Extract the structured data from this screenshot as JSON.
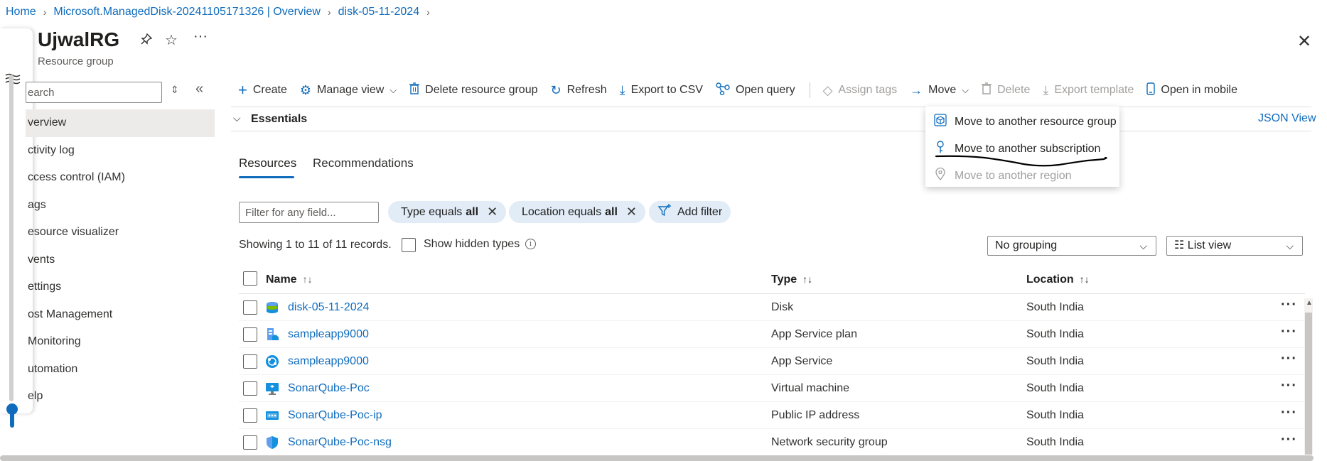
{
  "breadcrumb": {
    "items": [
      "Home",
      "Microsoft.ManagedDisk-20241105171326 | Overview",
      "disk-05-11-2024"
    ]
  },
  "header": {
    "title": "UjwalRG",
    "subtitle": "Resource group"
  },
  "sidebar": {
    "search_placeholder": "earch",
    "items": [
      {
        "label": "verview",
        "active": true
      },
      {
        "label": "ctivity log"
      },
      {
        "label": "ccess control (IAM)"
      },
      {
        "label": "ags"
      },
      {
        "label": "esource visualizer"
      },
      {
        "label": "vents"
      },
      {
        "label": "ettings"
      },
      {
        "label": "ost Management"
      },
      {
        "label": "Monitoring"
      },
      {
        "label": "utomation"
      },
      {
        "label": "elp"
      }
    ]
  },
  "toolbar": {
    "create": "Create",
    "manage_view": "Manage view",
    "delete_rg": "Delete resource group",
    "refresh": "Refresh",
    "export_csv": "Export to CSV",
    "open_query": "Open query",
    "assign_tags": "Assign tags",
    "move": "Move",
    "delete": "Delete",
    "export_template": "Export template",
    "open_mobile": "Open in mobile"
  },
  "essentials": {
    "label": "Essentials",
    "json_view": "JSON View"
  },
  "move_menu": {
    "items": [
      {
        "label": "Move to another resource group",
        "enabled": true
      },
      {
        "label": "Move to another subscription",
        "enabled": true
      },
      {
        "label": "Move to another region",
        "enabled": false
      }
    ]
  },
  "tabs": {
    "resources": "Resources",
    "recommendations": "Recommendations"
  },
  "filters": {
    "placeholder": "Filter for any field...",
    "type_prefix": "Type equals",
    "type_value": "all",
    "location_prefix": "Location equals",
    "location_value": "all",
    "add_filter": "Add filter"
  },
  "records": {
    "text": "Showing 1 to 11 of 11 records.",
    "show_hidden": "Show hidden types",
    "grouping": "No grouping",
    "view": "List view"
  },
  "table": {
    "columns": {
      "name": "Name",
      "type": "Type",
      "location": "Location"
    },
    "rows": [
      {
        "name": "disk-05-11-2024",
        "type": "Disk",
        "location": "South India",
        "icon": "disk-icon"
      },
      {
        "name": "sampleapp9000",
        "type": "App Service plan",
        "location": "South India",
        "icon": "app-service-plan-icon"
      },
      {
        "name": "sampleapp9000",
        "type": "App Service",
        "location": "South India",
        "icon": "app-service-icon"
      },
      {
        "name": "SonarQube-Poc",
        "type": "Virtual machine",
        "location": "South India",
        "icon": "virtual-machine-icon"
      },
      {
        "name": "SonarQube-Poc-ip",
        "type": "Public IP address",
        "location": "South India",
        "icon": "public-ip-icon"
      },
      {
        "name": "SonarQube-Poc-nsg",
        "type": "Network security group",
        "location": "South India",
        "icon": "nsg-shield-icon"
      }
    ]
  },
  "colors": {
    "accent": "#0f6cbd",
    "pill_bg": "#e1ecf7",
    "disabled": "#a19f9d"
  }
}
